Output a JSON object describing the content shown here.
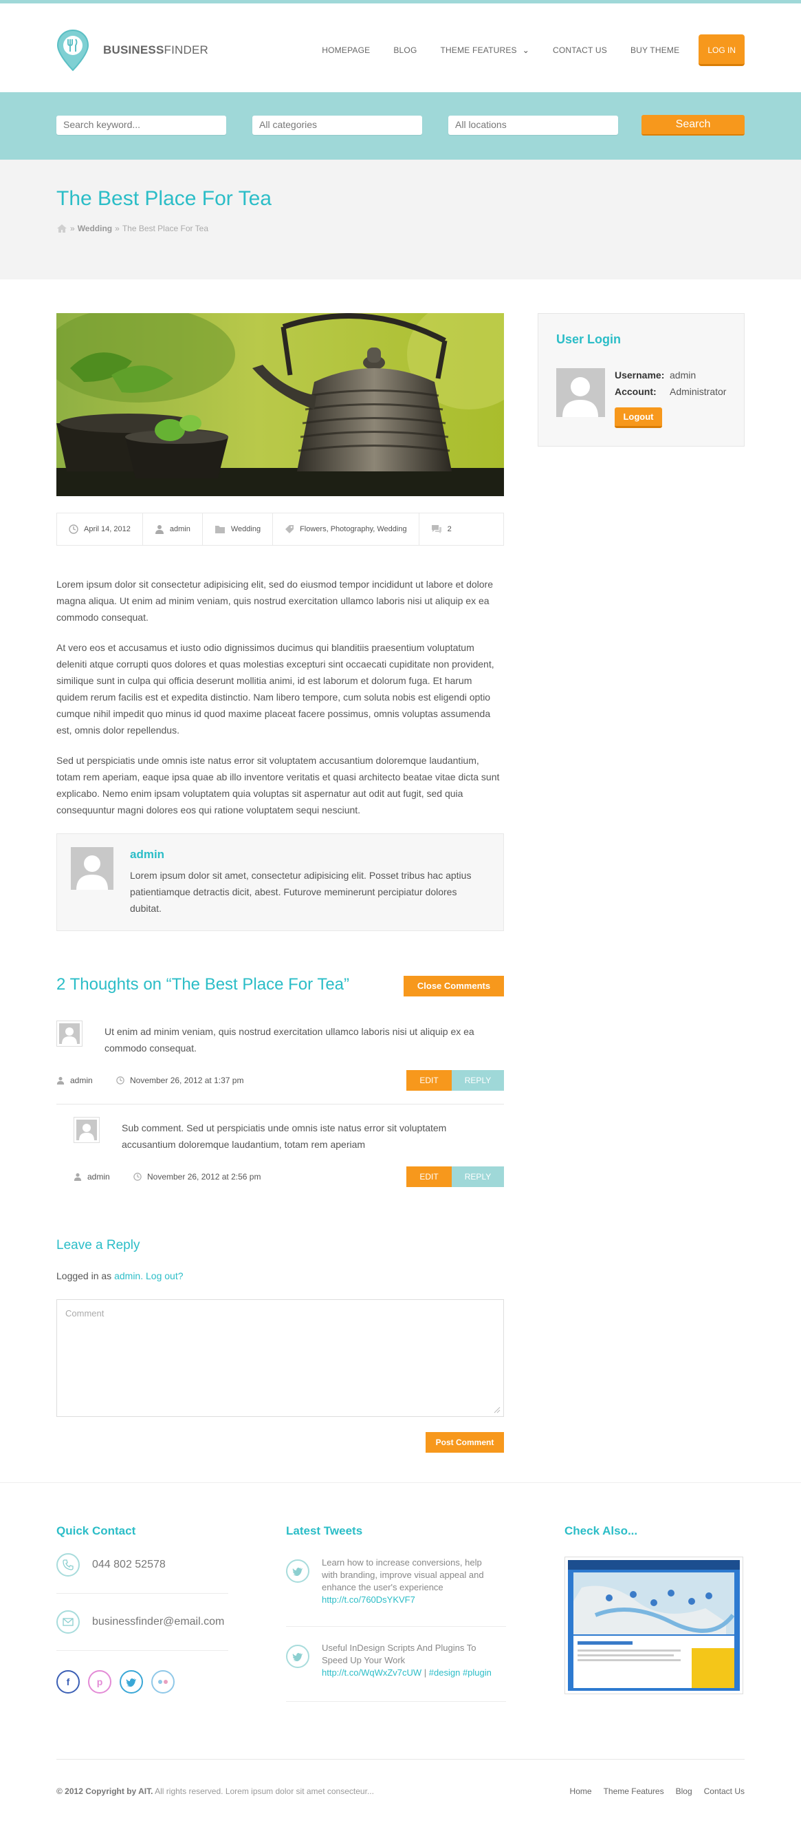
{
  "brand": {
    "name_bold": "BUSINESS",
    "name_light": "FINDER"
  },
  "nav": {
    "items": [
      "HOMEPAGE",
      "BLOG",
      "THEME FEATURES",
      "CONTACT US",
      "BUY THEME"
    ],
    "login": "LOG IN"
  },
  "search": {
    "keyword_placeholder": "Search keyword...",
    "category": "All categories",
    "location": "All locations",
    "button": "Search"
  },
  "page": {
    "title": "The Best Place For Tea",
    "breadcrumb": {
      "sep": "»",
      "category": "Wedding",
      "current": "The Best Place For Tea"
    }
  },
  "post": {
    "meta": {
      "date": "April 14, 2012",
      "author": "admin",
      "category": "Wedding",
      "tags": "Flowers, Photography, Wedding",
      "comments": "2"
    },
    "paragraphs": [
      "Lorem ipsum dolor sit consectetur adipisicing elit, sed do eiusmod tempor incididunt ut labore et dolore magna aliqua. Ut enim ad minim veniam, quis nostrud exercitation ullamco laboris nisi ut aliquip ex ea commodo consequat.",
      "At vero eos et accusamus et iusto odio dignissimos ducimus qui blanditiis praesentium voluptatum deleniti atque corrupti quos dolores et quas molestias excepturi sint occaecati cupiditate non provident, similique sunt in culpa qui officia deserunt mollitia animi, id est laborum et dolorum fuga. Et harum quidem rerum facilis est et expedita distinctio. Nam libero tempore, cum soluta nobis est eligendi optio cumque nihil impedit quo minus id quod maxime placeat facere possimus, omnis voluptas assumenda est, omnis dolor repellendus.",
      "Sed ut perspiciatis unde omnis iste natus error sit voluptatem accusantium doloremque laudantium, totam rem aperiam, eaque ipsa quae ab illo inventore veritatis et quasi architecto beatae vitae dicta sunt explicabo. Nemo enim ipsam voluptatem quia voluptas sit aspernatur aut odit aut fugit, sed quia consequuntur magni dolores eos qui ratione voluptatem sequi nesciunt."
    ],
    "author_box": {
      "name": "admin",
      "bio": "Lorem ipsum dolor sit amet, consectetur adipisicing elit. Posset tribus hac aptius patientiamque detractis dicit, abest. Futurove meminerunt percipiatur dolores dubitat."
    }
  },
  "comments": {
    "heading": "2 Thoughts on “The Best Place For Tea”",
    "close_label": "Close Comments",
    "edit_label": "EDIT",
    "reply_label": "REPLY",
    "list": [
      {
        "text": "Ut enim ad minim veniam, quis nostrud exercitation ullamco laboris nisi ut aliquip ex ea commodo consequat.",
        "author": "admin",
        "date": "November 26, 2012 at 1:37 pm"
      },
      {
        "text": "Sub comment. Sed ut perspiciatis unde omnis iste natus error sit voluptatem accusantium doloremque laudantium, totam rem aperiam",
        "author": "admin",
        "date": "November 26, 2012 at 2:56 pm"
      }
    ]
  },
  "reply": {
    "heading": "Leave a Reply",
    "logged_prefix": "Logged in as",
    "user_link": "admin.",
    "logout_link": "Log out?",
    "placeholder": "Comment",
    "post_button": "Post Comment"
  },
  "sidebar": {
    "title": "User Login",
    "username_label": "Username:",
    "username": "admin",
    "account_label": "Account:",
    "account": "Administrator",
    "logout": "Logout"
  },
  "footer": {
    "quick_contact": {
      "title": "Quick Contact",
      "phone": "044 802 52578",
      "email": "businessfinder@email.com"
    },
    "tweets": {
      "title": "Latest Tweets",
      "items": [
        {
          "text": "Learn how to increase conversions, help with branding, improve visual appeal and enhance the user's experience",
          "link": "http://t.co/760DsYKVF7",
          "tags": ""
        },
        {
          "text": "Useful InDesign Scripts And Plugins To Speed Up Your Work",
          "link": "http://t.co/WqWxZv7cUW",
          "tags": "#design #plugin"
        }
      ]
    },
    "check_also": {
      "title": "Check Also..."
    },
    "copyright_bold": "© 2012 Copyright by AIT.",
    "copyright_rest": "All rights reserved. Lorem ipsum dolor sit amet consecteur...",
    "links": [
      "Home",
      "Theme Features",
      "Blog",
      "Contact Us"
    ]
  },
  "colors": {
    "accent": "#2bbdc7",
    "orange": "#f7981c",
    "teal_band": "#9fd8d8"
  }
}
